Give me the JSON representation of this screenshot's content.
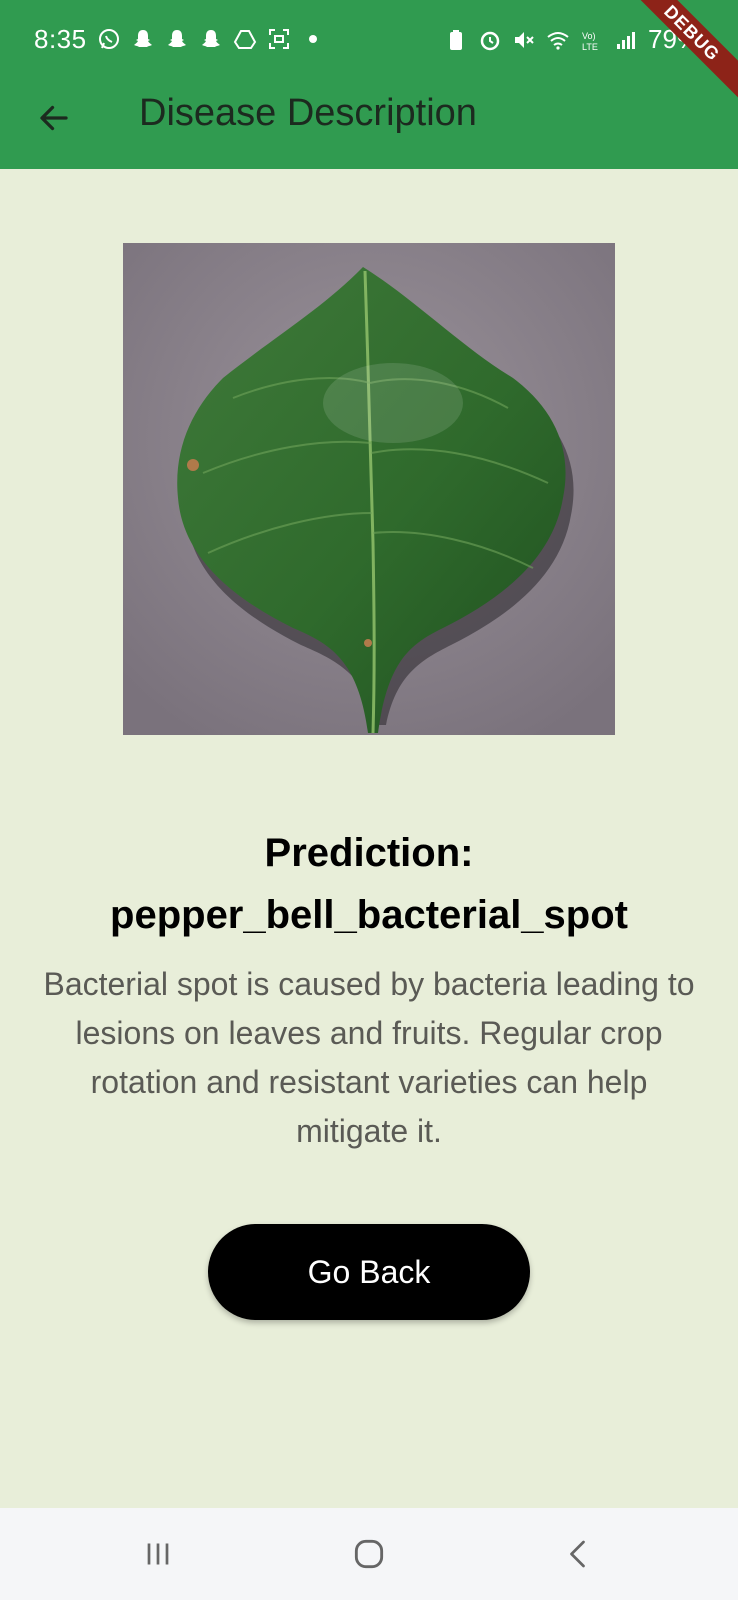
{
  "status_bar": {
    "time": "8:35",
    "battery": "79%",
    "left_icons": [
      "whatsapp-icon",
      "snapchat-icon",
      "snapchat-icon",
      "snapchat-icon",
      "drive-icon",
      "screenshot-icon",
      "dot-icon"
    ],
    "right_icons": [
      "battery-saver-icon",
      "alarm-icon",
      "mute-icon",
      "wifi-icon",
      "volte-icon",
      "signal-icon"
    ]
  },
  "debug_banner": "DEBUG",
  "app_bar": {
    "title": "Disease Description",
    "back_icon": "arrow-back-icon"
  },
  "content": {
    "prediction_text": "Prediction: pepper_bell_bacterial_spot",
    "description": "Bacterial spot is caused by bacteria leading to lesions on leaves and fruits. Regular crop rotation and resistant varieties can help mitigate it.",
    "go_back_label": "Go Back"
  },
  "nav_bar": {
    "icons": [
      "recent-apps-icon",
      "home-icon",
      "back-icon"
    ]
  },
  "colors": {
    "app_bar": "#309b50",
    "background": "#e8eed9",
    "button": "#000000",
    "debug_banner": "#8d2318"
  }
}
